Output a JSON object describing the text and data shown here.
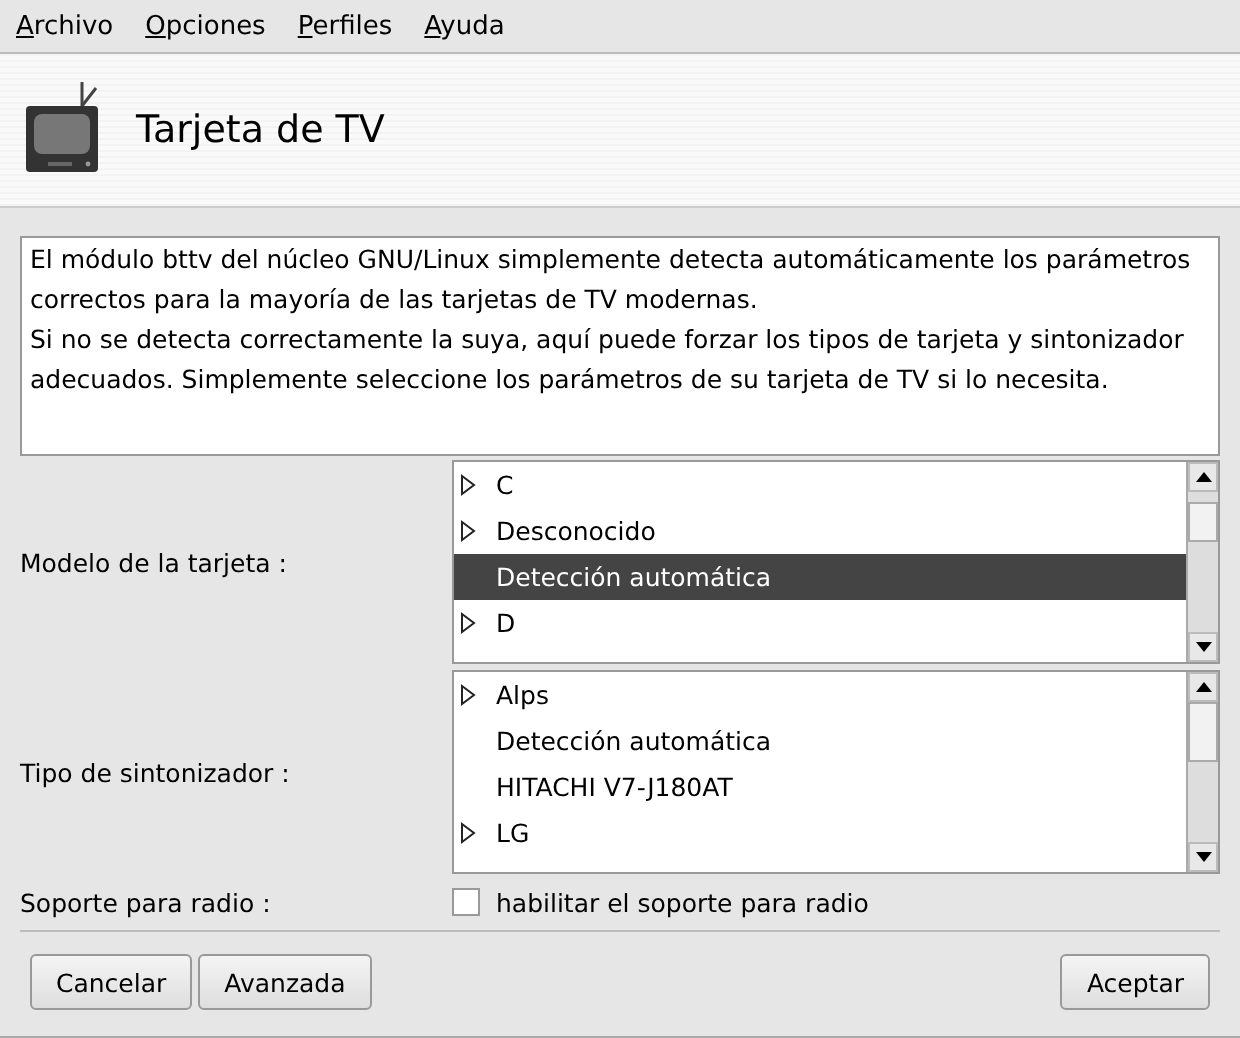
{
  "menu": [
    {
      "label": "Archivo"
    },
    {
      "label": "Opciones"
    },
    {
      "label": "Perfiles"
    },
    {
      "label": "Ayuda"
    }
  ],
  "header": {
    "title": "Tarjeta de TV"
  },
  "description": [
    "El módulo bttv del núcleo GNU/Linux simplemente detecta automáticamente los parámetros correctos para la mayoría de las tarjetas de TV modernas.",
    "Si no se detecta correctamente la suya, aquí puede forzar los tipos de tarjeta y sintonizador adecuados. Simplemente seleccione los parámetros de su tarjeta de TV si lo necesita."
  ],
  "card_model": {
    "label": "Modelo de la tarjeta :",
    "items": [
      {
        "label": "C",
        "expandable": true,
        "selected": false
      },
      {
        "label": "Desconocido",
        "expandable": true,
        "selected": false
      },
      {
        "label": "Detección automática",
        "expandable": false,
        "selected": true
      },
      {
        "label": "D",
        "expandable": true,
        "selected": false
      }
    ]
  },
  "tuner": {
    "label": "Tipo de sintonizador :",
    "items": [
      {
        "label": "Alps",
        "expandable": true,
        "selected": false
      },
      {
        "label": "Detección automática",
        "expandable": false,
        "selected": false
      },
      {
        "label": "HITACHI V7-J180AT",
        "expandable": false,
        "selected": false
      },
      {
        "label": "LG",
        "expandable": true,
        "selected": false
      }
    ]
  },
  "radio": {
    "label": "Soporte para radio :",
    "checkbox_label": "habilitar el soporte para radio",
    "checked": false
  },
  "buttons_left": [
    "Cancelar",
    "Avanzada"
  ],
  "buttons_right": [
    "Aceptar"
  ]
}
